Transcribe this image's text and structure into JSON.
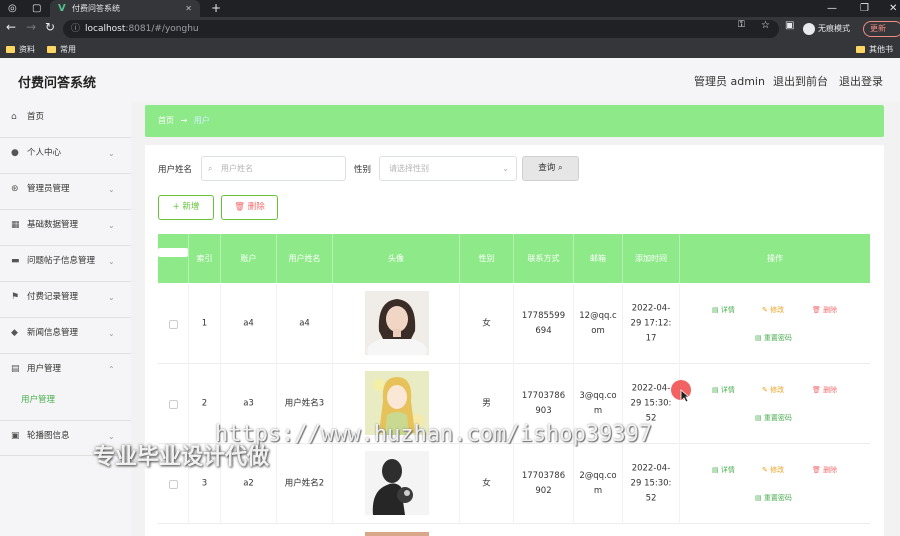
{
  "browser": {
    "tab_title": "付费问答系统",
    "url_host": "localhost",
    "url_rest": ":8081/#/yonghu",
    "incognito_label": "无痕模式",
    "update_label": "更新",
    "bookmarks": [
      "资料",
      "常用"
    ],
    "other_bookmarks": "其他书签"
  },
  "header": {
    "title": "付费问答系统",
    "admin_label": "管理员 admin",
    "back_front": "退出到前台",
    "logout": "退出登录"
  },
  "sidebar": {
    "items": [
      {
        "label": "首页",
        "icon": "home-icon"
      },
      {
        "label": "个人中心",
        "icon": "user-icon"
      },
      {
        "label": "管理员管理",
        "icon": "admin-icon"
      },
      {
        "label": "基础数据管理",
        "icon": "data-icon"
      },
      {
        "label": "问题帖子信息管理",
        "icon": "post-icon"
      },
      {
        "label": "付费记录管理",
        "icon": "flag-icon"
      },
      {
        "label": "新闻信息管理",
        "icon": "news-icon"
      },
      {
        "label": "用户管理",
        "icon": "users-icon"
      },
      {
        "label": "轮播图信息",
        "icon": "carousel-icon"
      }
    ],
    "sub_item": "用户管理"
  },
  "breadcrumb": {
    "home": "首页",
    "sep": "→",
    "current": "用户"
  },
  "search": {
    "name_label": "用户姓名",
    "name_placeholder": "用户姓名",
    "gender_label": "性别",
    "gender_placeholder": "请选择性别",
    "query_button": "查询"
  },
  "actions": {
    "add": "+ 新增",
    "delete": "删除"
  },
  "table": {
    "headers": [
      "索引",
      "账户",
      "用户姓名",
      "头像",
      "性别",
      "联系方式",
      "邮箱",
      "添加时间",
      "操作"
    ],
    "ops": {
      "detail": "详情",
      "edit": "修改",
      "delete": "删除",
      "reset": "重置密码"
    },
    "rows": [
      {
        "index": "1",
        "account": "a4",
        "name": "a4",
        "gender": "女",
        "phone1": "17785599",
        "phone2": "694",
        "mail1": "12@qq.c",
        "mail2": "om",
        "date1": "2022-04-",
        "date2": "29 17:12:",
        "date3": "17"
      },
      {
        "index": "2",
        "account": "a3",
        "name": "用户姓名3",
        "gender": "男",
        "phone1": "17703786",
        "phone2": "903",
        "mail1": "3@qq.co",
        "mail2": "m",
        "date1": "2022-04-",
        "date2": "29 15:30:",
        "date3": "52"
      },
      {
        "index": "3",
        "account": "a2",
        "name": "用户姓名2",
        "gender": "女",
        "phone1": "17703786",
        "phone2": "902",
        "mail1": "2@qq.co",
        "mail2": "m",
        "date1": "2022-04-",
        "date2": "29 15:30:",
        "date3": "52"
      }
    ]
  },
  "watermark": {
    "url": "https://www.huzhan.com/ishop39397",
    "slogan": "专业毕业设计代做"
  },
  "colors": {
    "accent_green": "#8eea89",
    "primary_green": "#4caf50",
    "edit_orange": "#f0a020",
    "delete_red": "#f56c6c"
  }
}
